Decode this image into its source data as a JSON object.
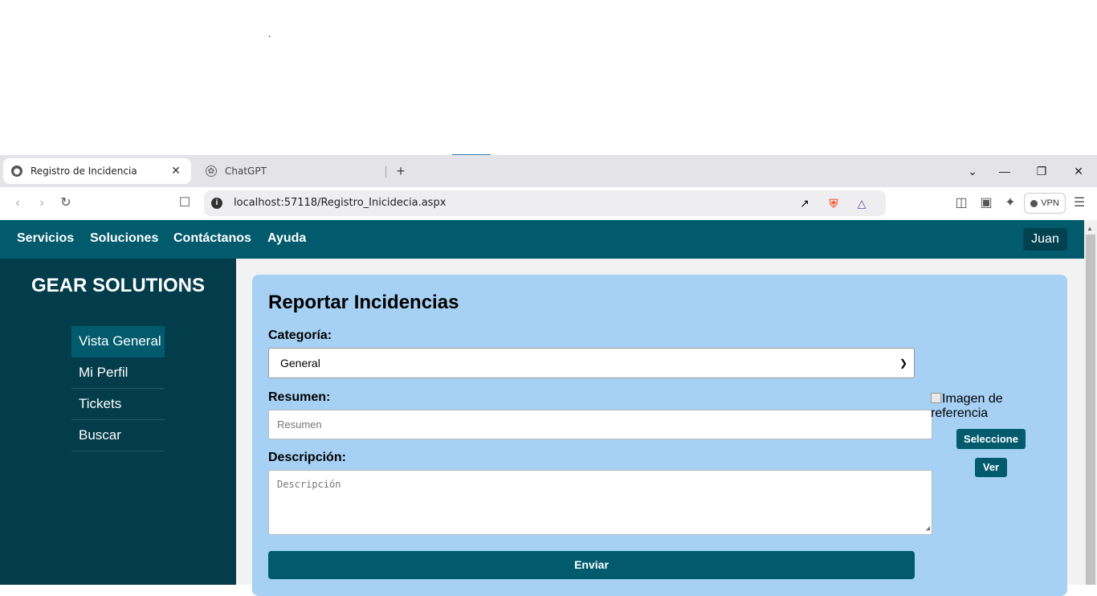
{
  "desktop": {
    "dot": "."
  },
  "browser": {
    "tabs": [
      {
        "title": "Registro de Incidencia",
        "active": true
      },
      {
        "title": "ChatGPT",
        "active": false
      }
    ],
    "new_tab_symbol": "+",
    "url": "localhost:57118/Registro_Inicidecia.aspx",
    "vpn_label": "VPN",
    "icons": [
      "back-icon",
      "forward-icon",
      "reload-icon",
      "bookmark-icon",
      "site-info-icon",
      "share-icon",
      "brave-shields-icon",
      "brave-rewards-icon",
      "sidebar-icon",
      "wallet-icon",
      "leo-ai-icon",
      "menu-icon"
    ]
  },
  "nav": {
    "links": [
      "Servicios",
      "Soluciones",
      "Contáctanos",
      "Ayuda"
    ],
    "user": "Juan"
  },
  "sidebar": {
    "brand": "GEAR SOLUTIONS",
    "items": [
      {
        "label": "Vista General",
        "active": true
      },
      {
        "label": "Mi Perfil",
        "active": false
      },
      {
        "label": "Tickets",
        "active": false
      },
      {
        "label": "Buscar",
        "active": false
      }
    ]
  },
  "form": {
    "title": "Reportar Incidencias",
    "category_label": "Categoría:",
    "category_value": "General",
    "summary_label": "Resumen:",
    "summary_placeholder": "Resumen",
    "description_label": "Descripción:",
    "description_placeholder": "Descripción",
    "submit_label": "Enviar",
    "image_alt": "Imagen de referencia",
    "select_button": "Seleccione",
    "view_button": "Ver"
  },
  "colors": {
    "nav_bg": "#015b6d",
    "sidebar_bg": "#033c4a",
    "card_bg": "#a6d1f4",
    "button_bg": "#015b6d"
  }
}
